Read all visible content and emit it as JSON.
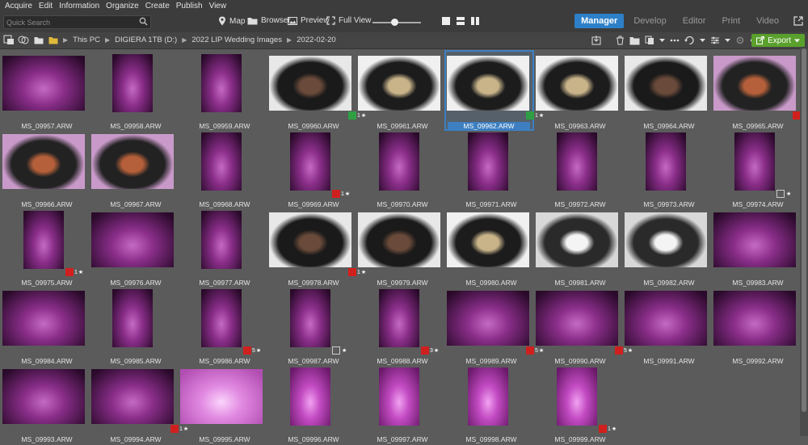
{
  "menu": [
    "Acquire",
    "Edit",
    "Information",
    "Organize",
    "Create",
    "Publish",
    "View"
  ],
  "search": {
    "placeholder": "Quick Search"
  },
  "views": [
    {
      "label": "Map",
      "icon": "map-pin-icon"
    },
    {
      "label": "Browser",
      "icon": "folder-icon"
    },
    {
      "label": "Preview",
      "icon": "image-icon"
    },
    {
      "label": "Full View",
      "icon": "fullscreen-icon"
    }
  ],
  "zoom": 0.45,
  "modes": [
    "Manager",
    "Develop",
    "Editor",
    "Print",
    "Video"
  ],
  "active_mode": "Manager",
  "breadcrumb": [
    "This PC",
    "DIGIERA 1TB (D:)",
    "2022 LIP Wedding Images",
    "2022-02-20"
  ],
  "export_label": "Export",
  "colors": {
    "accent": "#2d80c8",
    "export": "#5aa02c",
    "selected": "#3d7fc1",
    "label_red": "#d0201e",
    "label_green": "#2ea043"
  },
  "photos": [
    {
      "file": "MS_09957.ARW",
      "tone": "purple",
      "orient": "landscape"
    },
    {
      "file": "MS_09958.ARW",
      "tone": "purple",
      "orient": "portrait"
    },
    {
      "file": "MS_09959.ARW",
      "tone": "purple",
      "orient": "portrait"
    },
    {
      "file": "MS_09960.ARW",
      "tone": "food-dark",
      "orient": "landscape",
      "label": "green",
      "rating": "1"
    },
    {
      "file": "MS_09961.ARW",
      "tone": "food-white",
      "orient": "landscape"
    },
    {
      "file": "MS_09962.ARW",
      "tone": "food-white",
      "orient": "landscape",
      "label": "green",
      "rating": "1",
      "selected": true
    },
    {
      "file": "MS_09963.ARW",
      "tone": "food-white",
      "orient": "landscape"
    },
    {
      "file": "MS_09964.ARW",
      "tone": "food-dark",
      "orient": "landscape"
    },
    {
      "file": "MS_09965.ARW",
      "tone": "food-pink",
      "orient": "landscape",
      "label": "red",
      "rating": "1"
    },
    {
      "file": "MS_09966.ARW",
      "tone": "food-pink",
      "orient": "landscape"
    },
    {
      "file": "MS_09967.ARW",
      "tone": "food-pink",
      "orient": "landscape"
    },
    {
      "file": "MS_09968.ARW",
      "tone": "purple",
      "orient": "portrait"
    },
    {
      "file": "MS_09969.ARW",
      "tone": "purple",
      "orient": "portrait",
      "label": "red",
      "rating": "1"
    },
    {
      "file": "MS_09970.ARW",
      "tone": "purple",
      "orient": "portrait"
    },
    {
      "file": "MS_09971.ARW",
      "tone": "purple",
      "orient": "portrait"
    },
    {
      "file": "MS_09972.ARW",
      "tone": "purple",
      "orient": "portrait"
    },
    {
      "file": "MS_09973.ARW",
      "tone": "purple",
      "orient": "portrait"
    },
    {
      "file": "MS_09974.ARW",
      "tone": "purple",
      "orient": "portrait",
      "label": "none",
      "rating": ""
    },
    {
      "file": "MS_09975.ARW",
      "tone": "purple",
      "orient": "portrait",
      "label": "red",
      "rating": "1"
    },
    {
      "file": "MS_09976.ARW",
      "tone": "purple",
      "orient": "landscape"
    },
    {
      "file": "MS_09977.ARW",
      "tone": "purple",
      "orient": "portrait"
    },
    {
      "file": "MS_09978.ARW",
      "tone": "food-dark",
      "orient": "landscape",
      "label": "red",
      "rating": "1"
    },
    {
      "file": "MS_09979.ARW",
      "tone": "food-dark",
      "orient": "landscape"
    },
    {
      "file": "MS_09980.ARW",
      "tone": "food-white",
      "orient": "landscape"
    },
    {
      "file": "MS_09981.ARW",
      "tone": "table-white",
      "orient": "landscape"
    },
    {
      "file": "MS_09982.ARW",
      "tone": "table-white",
      "orient": "landscape"
    },
    {
      "file": "MS_09983.ARW",
      "tone": "purple",
      "orient": "landscape"
    },
    {
      "file": "MS_09984.ARW",
      "tone": "purple",
      "orient": "landscape"
    },
    {
      "file": "MS_09985.ARW",
      "tone": "purple",
      "orient": "portrait"
    },
    {
      "file": "MS_09986.ARW",
      "tone": "purple",
      "orient": "portrait",
      "label": "red",
      "rating": "5"
    },
    {
      "file": "MS_09987.ARW",
      "tone": "purple",
      "orient": "portrait",
      "label": "none",
      "rating": ""
    },
    {
      "file": "MS_09988.ARW",
      "tone": "purple",
      "orient": "portrait",
      "label": "red",
      "rating": "3"
    },
    {
      "file": "MS_09989.ARW",
      "tone": "purple",
      "orient": "landscape",
      "label": "red",
      "rating": "5"
    },
    {
      "file": "MS_09990.ARW",
      "tone": "purple",
      "orient": "landscape",
      "label": "red",
      "rating": "5"
    },
    {
      "file": "MS_09991.ARW",
      "tone": "purple",
      "orient": "landscape"
    },
    {
      "file": "MS_09992.ARW",
      "tone": "purple",
      "orient": "landscape"
    },
    {
      "file": "MS_09993.ARW",
      "tone": "purple",
      "orient": "landscape"
    },
    {
      "file": "MS_09994.ARW",
      "tone": "purple",
      "orient": "landscape",
      "label": "red",
      "rating": "1"
    },
    {
      "file": "MS_09995.ARW",
      "tone": "pink-light",
      "orient": "landscape"
    },
    {
      "file": "MS_09996.ARW",
      "tone": "pink-bright",
      "orient": "portrait"
    },
    {
      "file": "MS_09997.ARW",
      "tone": "pink-bright",
      "orient": "portrait"
    },
    {
      "file": "MS_09998.ARW",
      "tone": "pink-bright",
      "orient": "portrait"
    },
    {
      "file": "MS_09999.ARW",
      "tone": "pink-bright",
      "orient": "portrait",
      "label": "red",
      "rating": "1"
    }
  ]
}
